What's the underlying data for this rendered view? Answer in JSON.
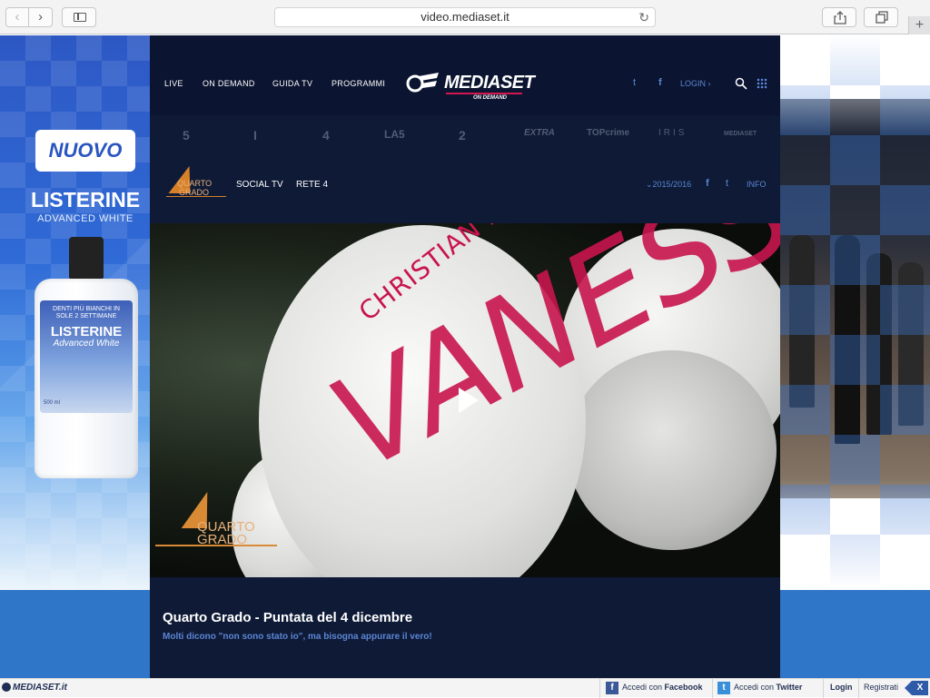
{
  "browser": {
    "back_glyph": "‹",
    "forward_glyph": "›",
    "url": "video.mediaset.it",
    "reload_glyph": "↻",
    "newtab_glyph": "+"
  },
  "ad_left": {
    "badge": "NUOVO",
    "brand": "LISTERINE",
    "product": "ADVANCED WHITE",
    "label_top": "DENTI PIÙ BIANCHI IN SOLE 2 SETTIMANE",
    "label_brand": "LISTERINE",
    "label_name": "Advanced White",
    "label_small": "500 ml"
  },
  "nav": {
    "live": "LIVE",
    "on_demand": "ON DEMAND",
    "guida_tv": "GUIDA TV",
    "programmi": "PROGRAMMI",
    "logo_text": "MEDIASET",
    "logo_sub": "ON DEMAND",
    "twitter_glyph": "t",
    "facebook_glyph": "f",
    "login": "LOGIN ›"
  },
  "channels": [
    "5",
    "I",
    "4",
    "LA5",
    "2",
    "EXTRA",
    "TOPcrime",
    "IRIS",
    "MEDIASET"
  ],
  "program": {
    "logo_line1": "QUARTO",
    "logo_line2": "GRADO",
    "social_tv": "SOCIAL TV",
    "rete": "RETE 4",
    "season": "⌄2015/2016",
    "facebook_glyph": "f",
    "twitter_glyph": "t",
    "info": "INFO"
  },
  "video": {
    "scribble1": "CHRISTIAN LORI",
    "scribble2": "VANESSA",
    "watermark_line1": "QUARTO",
    "watermark_line2": "GRADO"
  },
  "episode": {
    "title": "Quarto Grado - Puntata del 4 dicembre",
    "description": "Molti dicono \"non sono stato io\", ma bisogna appurare il vero!"
  },
  "bottombar": {
    "logo": "MEDIASET.it",
    "facebook_prefix": "Accedi con",
    "facebook_name": "Facebook",
    "twitter_prefix": "Accedi con",
    "twitter_name": "Twitter",
    "login": "Login",
    "register": "Registrati",
    "close": "X"
  }
}
